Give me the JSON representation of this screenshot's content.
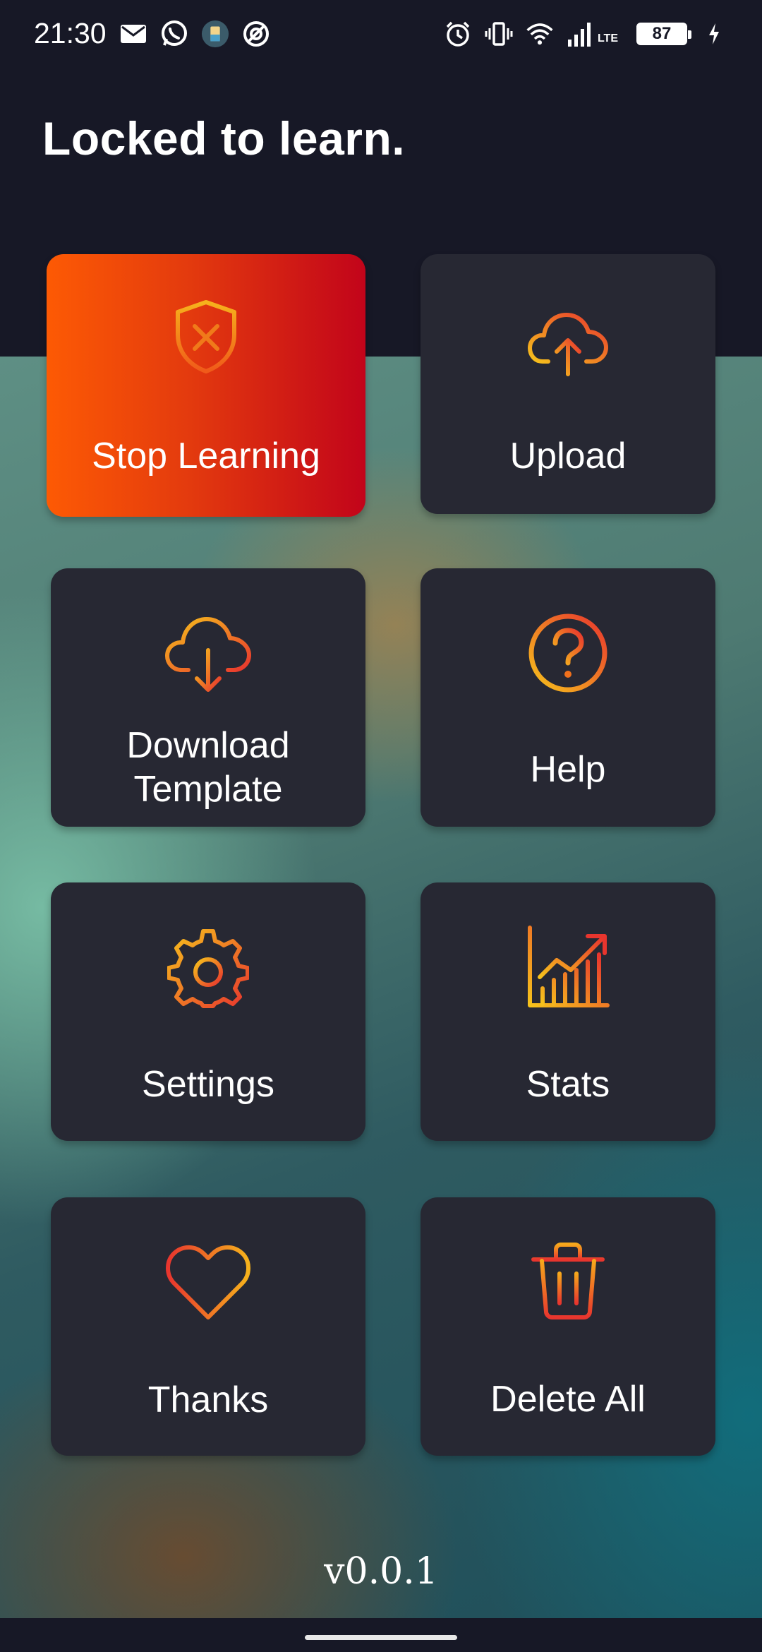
{
  "status_bar": {
    "time": "21:30",
    "network_label": "LTE",
    "battery_level": "87",
    "icons": [
      "gmail-icon",
      "whatsapp-icon",
      "app-notification-icon",
      "data-saver-icon",
      "alarm-icon",
      "vibrate-icon",
      "wifi-icon",
      "signal-icon",
      "battery-icon",
      "charging-icon"
    ]
  },
  "header": {
    "title": "Locked to learn."
  },
  "tiles": [
    {
      "label": "Stop Learning",
      "icon": "shield-x-icon",
      "active": true
    },
    {
      "label": "Upload",
      "icon": "cloud-upload-icon",
      "active": false
    },
    {
      "label": "Download\nTemplate",
      "icon": "cloud-download-icon",
      "active": false
    },
    {
      "label": "Help",
      "icon": "help-circle-icon",
      "active": false
    },
    {
      "label": "Settings",
      "icon": "gear-icon",
      "active": false
    },
    {
      "label": "Stats",
      "icon": "chart-icon",
      "active": false
    },
    {
      "label": "Thanks",
      "icon": "heart-icon",
      "active": false
    },
    {
      "label": "Delete All",
      "icon": "trash-icon",
      "active": false
    }
  ],
  "footer": {
    "version": "v0.0.1"
  },
  "colors": {
    "gradient_start": "#f5c518",
    "gradient_end": "#e8352e",
    "active_tile_start": "#fd5a04",
    "active_tile_end": "#c2041a",
    "tile_bg": "#272833",
    "header_bg": "#171826"
  }
}
